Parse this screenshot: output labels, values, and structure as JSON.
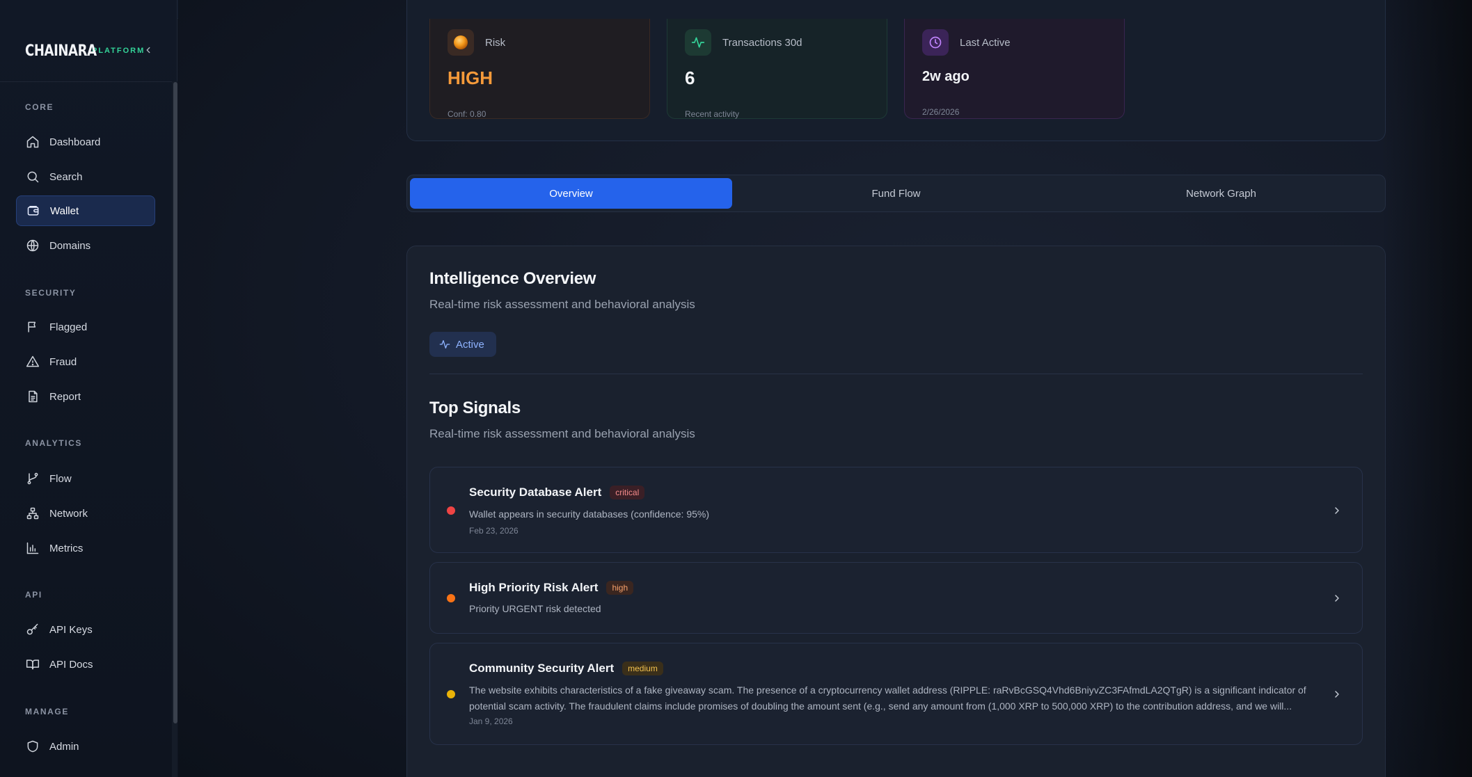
{
  "brand": {
    "name": "CHAINARA",
    "sub": "PLATFORM"
  },
  "sidebar": {
    "sections": [
      {
        "label": "CORE"
      },
      {
        "label": "SECURITY"
      },
      {
        "label": "ANALYTICS"
      },
      {
        "label": "API"
      },
      {
        "label": "MANAGE"
      }
    ],
    "items": [
      {
        "label": "Dashboard",
        "icon": "home-icon"
      },
      {
        "label": "Search",
        "icon": "search-icon"
      },
      {
        "label": "Wallet",
        "icon": "wallet-icon",
        "active": true
      },
      {
        "label": "Domains",
        "icon": "globe-icon"
      },
      {
        "label": "Flagged",
        "icon": "flag-icon"
      },
      {
        "label": "Fraud",
        "icon": "alert-triangle-icon"
      },
      {
        "label": "Report",
        "icon": "file-text-icon"
      },
      {
        "label": "Flow",
        "icon": "git-branch-icon"
      },
      {
        "label": "Network",
        "icon": "network-icon"
      },
      {
        "label": "Metrics",
        "icon": "bar-chart-icon"
      },
      {
        "label": "API Keys",
        "icon": "key-icon"
      },
      {
        "label": "API Docs",
        "icon": "book-open-icon"
      },
      {
        "label": "Admin",
        "icon": "shield-icon"
      }
    ]
  },
  "stats": {
    "risk": {
      "label": "Risk",
      "value": "HIGH",
      "sub": "Conf: 0.80"
    },
    "transactions": {
      "label": "Transactions 30d",
      "value": "6",
      "sub": "Recent activity"
    },
    "last_active": {
      "label": "Last Active",
      "value": "2w ago",
      "sub": "2/26/2026"
    }
  },
  "tabs": [
    {
      "label": "Overview",
      "active": true
    },
    {
      "label": "Fund Flow"
    },
    {
      "label": "Network Graph"
    }
  ],
  "overview": {
    "title": "Intelligence Overview",
    "subtitle": "Real-time risk assessment and behavioral analysis",
    "status": "Active"
  },
  "top_signals": {
    "title": "Top Signals",
    "subtitle": "Real-time risk assessment and behavioral analysis",
    "items": [
      {
        "title": "Security Database Alert",
        "severity": "critical",
        "description": "Wallet appears in security databases (confidence: 95%)",
        "date": "Feb 23, 2026",
        "color": "#ef4444"
      },
      {
        "title": "High Priority Risk Alert",
        "severity": "high",
        "description": "Priority URGENT risk detected",
        "date": "",
        "color": "#f97316"
      },
      {
        "title": "Community Security Alert",
        "severity": "medium",
        "description": "The website exhibits characteristics of a fake giveaway scam. The presence of a cryptocurrency wallet address (RIPPLE: raRvBcGSQ4Vhd6BniyvZC3FAfmdLA2QTgR) is a significant indicator of potential scam activity. The fraudulent claims include promises of doubling the amount sent (e.g., send any amount from (1,000 XRP to 500,000 XRP) to the contribution address, and we will...",
        "date": "Jan 9, 2026",
        "color": "#eab308"
      }
    ]
  },
  "colors": {
    "accent": "#2563eb",
    "risk_high": "#f59a3a",
    "brand_accent": "#34d399"
  }
}
